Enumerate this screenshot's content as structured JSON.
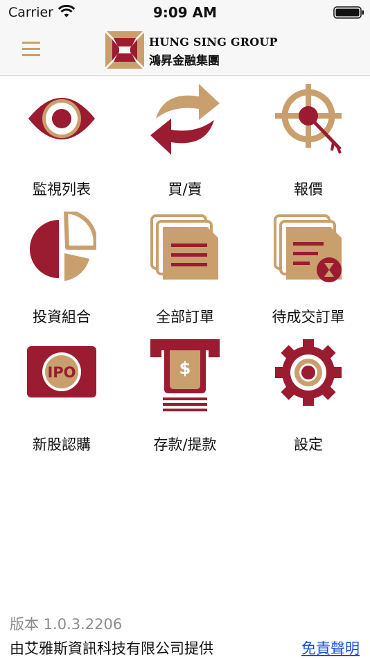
{
  "status_bar": {
    "carrier": "Carrier",
    "time": "9:09 AM"
  },
  "header": {
    "brand_en": "HUNG SING GROUP",
    "brand_zh": "鴻昇金融集團"
  },
  "colors": {
    "crimson": "#9b1b30",
    "gold": "#c9a06d",
    "link": "#1a4fd6"
  },
  "menu": [
    {
      "label": "監視列表",
      "icon": "eye-icon"
    },
    {
      "label": "買/賣",
      "icon": "exchange-arrows-icon"
    },
    {
      "label": "報價",
      "icon": "crosshair-icon"
    },
    {
      "label": "投資組合",
      "icon": "pie-chart-icon"
    },
    {
      "label": "全部訂單",
      "icon": "documents-icon"
    },
    {
      "label": "待成交訂單",
      "icon": "pending-documents-icon"
    },
    {
      "label": "新股認購",
      "icon": "ipo-icon",
      "icon_text": "IPO"
    },
    {
      "label": "存款/提款",
      "icon": "cash-withdraw-icon"
    },
    {
      "label": "設定",
      "icon": "gear-icon"
    }
  ],
  "footer": {
    "version": "版本 1.0.3.2206",
    "provider": "由艾雅斯資訊科技有限公司提供",
    "disclaimer": "免責聲明"
  }
}
